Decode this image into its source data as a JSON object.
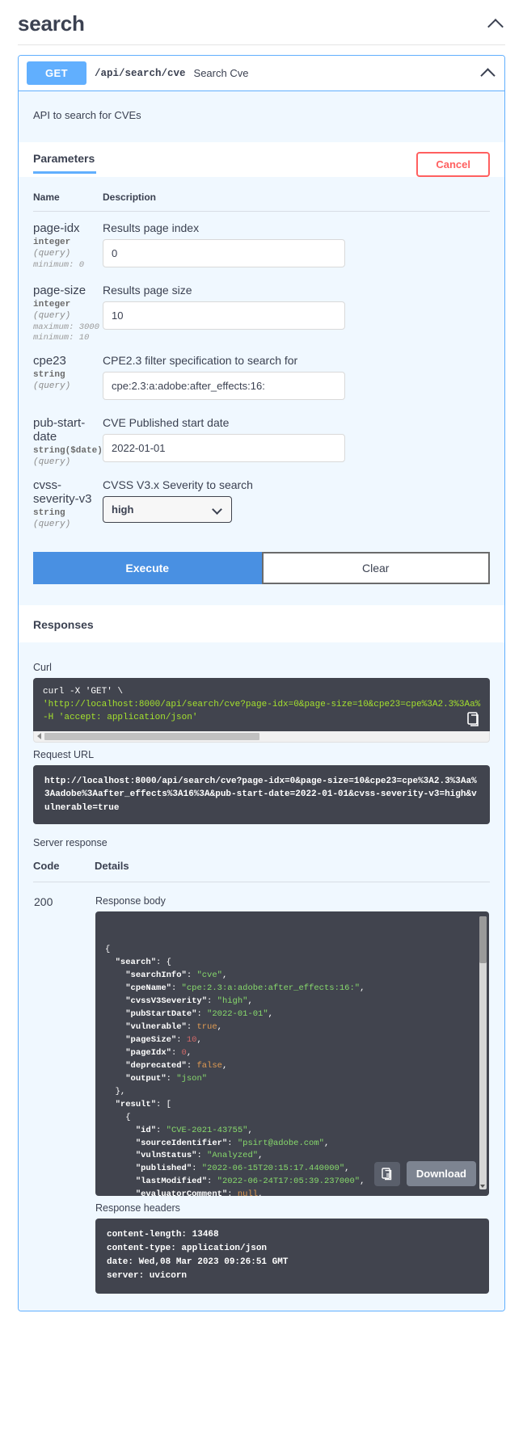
{
  "tag": {
    "title": "search",
    "collapse_icon": "chevron-up-icon"
  },
  "operation": {
    "method": "GET",
    "path": "/api/search/cve",
    "summary": "Search Cve",
    "description": "API to search for CVEs",
    "collapse_icon": "chevron-up-icon"
  },
  "parameters_section": {
    "tab_label": "Parameters",
    "cancel_label": "Cancel",
    "columns": {
      "name": "Name",
      "description": "Description"
    },
    "rows": [
      {
        "name": "page-idx",
        "type": "integer",
        "in": "(query)",
        "constraints": [
          "minimum: 0"
        ],
        "description": "Results page index",
        "control": "text",
        "value": "0",
        "placeholder": ""
      },
      {
        "name": "page-size",
        "type": "integer",
        "in": "(query)",
        "constraints": [
          "maximum: 3000",
          "minimum: 10"
        ],
        "description": "Results page size",
        "control": "text",
        "value": "10",
        "placeholder": ""
      },
      {
        "name": "cpe23",
        "type": "string",
        "in": "(query)",
        "constraints": [],
        "description": "CPE2.3 filter specification to search for",
        "control": "text",
        "value": "cpe:2.3:a:adobe:after_effects:16:",
        "placeholder": ""
      },
      {
        "name": "pub-start-date",
        "type": "string($date)",
        "in": "(query)",
        "constraints": [],
        "description": "CVE Published start date",
        "control": "text",
        "value": "2022-01-01",
        "placeholder": ""
      },
      {
        "name": "cvss-severity-v3",
        "type": "string",
        "in": "(query)",
        "constraints": [],
        "description": "CVSS V3.x Severity to search",
        "control": "select",
        "value": "high",
        "options": [
          "high"
        ],
        "dropdown_icon": "chevron-down-icon"
      }
    ],
    "execute_label": "Execute",
    "clear_label": "Clear"
  },
  "responses_section": {
    "title": "Responses",
    "curl_label": "Curl",
    "curl_command": "curl -X 'GET' \\\n  'http://localhost:8000/api/search/cve?page-idx=0&page-size=10&cpe23=cpe%3A2.3%3Aa%\n  -H 'accept: application/json'",
    "curl_line1": "curl -X 'GET' \\",
    "curl_line2": "'http://localhost:8000/api/search/cve?page-idx=0&page-size=10&cpe23=cpe%3A2.3%3Aa%",
    "curl_line3": "-H 'accept: application/json'",
    "curl_copy_icon": "copy-icon",
    "request_url_label": "Request URL",
    "request_url": "http://localhost:8000/api/search/cve?page-idx=0&page-size=10&cpe23=cpe%3A2.3%3Aa%3Aadobe%3Aafter_effects%3A16%3A&pub-start-date=2022-01-01&cvss-severity-v3=high&vulnerable=true",
    "server_response_label": "Server response",
    "columns": {
      "code": "Code",
      "details": "Details"
    },
    "code": "200",
    "response_body_label": "Response body",
    "copy_icon": "copy-icon",
    "download_label": "Download",
    "response_headers_label": "Response headers",
    "response_headers": "content-length: 13468\ncontent-type: application/json\ndate: Wed,08 Mar 2023 09:26:51 GMT\nserver: uvicorn",
    "response_body": {
      "search": {
        "searchInfo": "cve",
        "cpeName": "cpe:2.3:a:adobe:after_effects:16:",
        "cvssV3Severity": "high",
        "pubStartDate": "2022-01-01",
        "vulnerable": true,
        "pageSize": 10,
        "pageIdx": 0,
        "deprecated": false,
        "output": "json"
      },
      "result": [
        {
          "id": "CVE-2021-43755",
          "sourceIdentifier": "psirt@adobe.com",
          "vulnStatus": "Analyzed",
          "published": "2022-06-15T20:15:17.440000",
          "lastModified": "2022-06-24T17:05:39.237000",
          "evaluatorComment": null,
          "evaluatorSolution": null,
          "evaluatorImpact": null,
          "cisaExploitAdd": null,
          "cisaActionDue": null,
          "cisaRequiredAction": null,
          "cisaVulnerabilityName": null,
          "descriptions": []
        }
      ]
    }
  },
  "colors": {
    "method_blue": "#61affe",
    "execute_blue": "#4990e2",
    "cancel_red": "#ff6060",
    "code_bg": "#41444e",
    "panel_bg": "#f0f8ff"
  }
}
